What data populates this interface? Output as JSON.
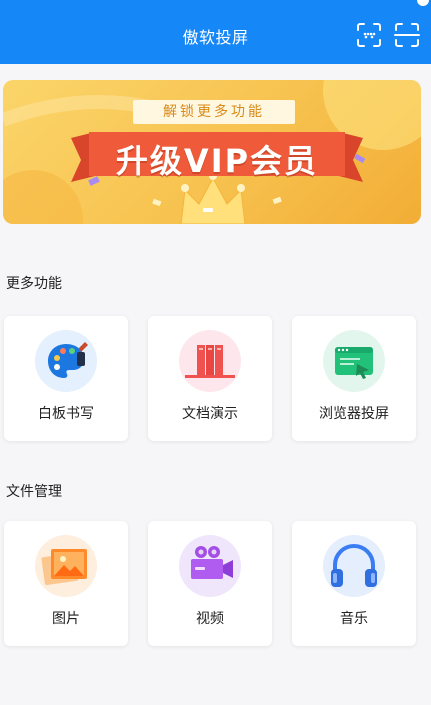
{
  "header": {
    "title": "傲软投屏",
    "background": "#1687f7"
  },
  "banner": {
    "subtitle": "解锁更多功能",
    "headline": "升级VIP会员"
  },
  "sections": {
    "more_features": {
      "title": "更多功能",
      "items": [
        {
          "label": "白板书写",
          "icon": "palette-icon"
        },
        {
          "label": "文档演示",
          "icon": "books-icon"
        },
        {
          "label": "浏览器投屏",
          "icon": "browser-icon"
        }
      ]
    },
    "file_management": {
      "title": "文件管理",
      "items": [
        {
          "label": "图片",
          "icon": "image-icon"
        },
        {
          "label": "视频",
          "icon": "video-camera-icon"
        },
        {
          "label": "音乐",
          "icon": "headphones-icon"
        }
      ]
    }
  }
}
